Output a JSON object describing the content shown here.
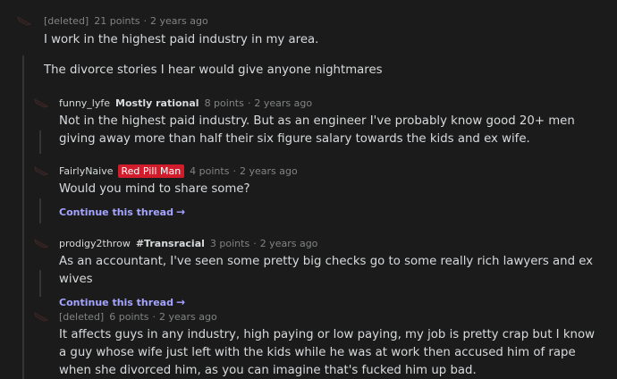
{
  "colors": {
    "background": "#1b1b1b",
    "text": "#d7dadc",
    "muted": "#818384",
    "thread_line": "#343536",
    "continue_link": "#a5a4ff",
    "red_flair": "#d01c2b"
  },
  "comments": [
    {
      "author": "[deleted]",
      "flair": "",
      "points": "21 points",
      "time": "2 years ago",
      "paragraphs": [
        "I work in the highest paid industry in my area.",
        "The divorce stories I hear would give anyone nightmares"
      ]
    },
    {
      "author": "funny_lyfe",
      "flair": "Mostly rational",
      "points": "8 points",
      "time": "2 years ago",
      "paragraphs": [
        "Not in the highest paid industry. But as an engineer I've probably know good 20+ men giving away more than half their six figure salary towards the kids and ex wife."
      ]
    },
    {
      "author": "FairlyNaive",
      "flair": "Red Pill Man",
      "points": "4 points",
      "time": "2 years ago",
      "paragraphs": [
        "Would you mind to share some?"
      ],
      "continue": "Continue this thread"
    },
    {
      "author": "prodigy2throw",
      "flair": "#Transracial",
      "points": "3 points",
      "time": "2 years ago",
      "paragraphs": [
        "As an accountant, I've seen some pretty big checks go to some really rich lawyers and ex wives"
      ],
      "continue": "Continue this thread"
    },
    {
      "author": "[deleted]",
      "flair": "",
      "points": "6 points",
      "time": "2 years ago",
      "paragraphs": [
        "It affects guys in any industry, high paying or low paying, my job is pretty crap but I know a guy whose wife just left with the kids while he was at work then accused him of rape when she divorced him, as you can imagine that's fucked him up bad."
      ]
    }
  ]
}
